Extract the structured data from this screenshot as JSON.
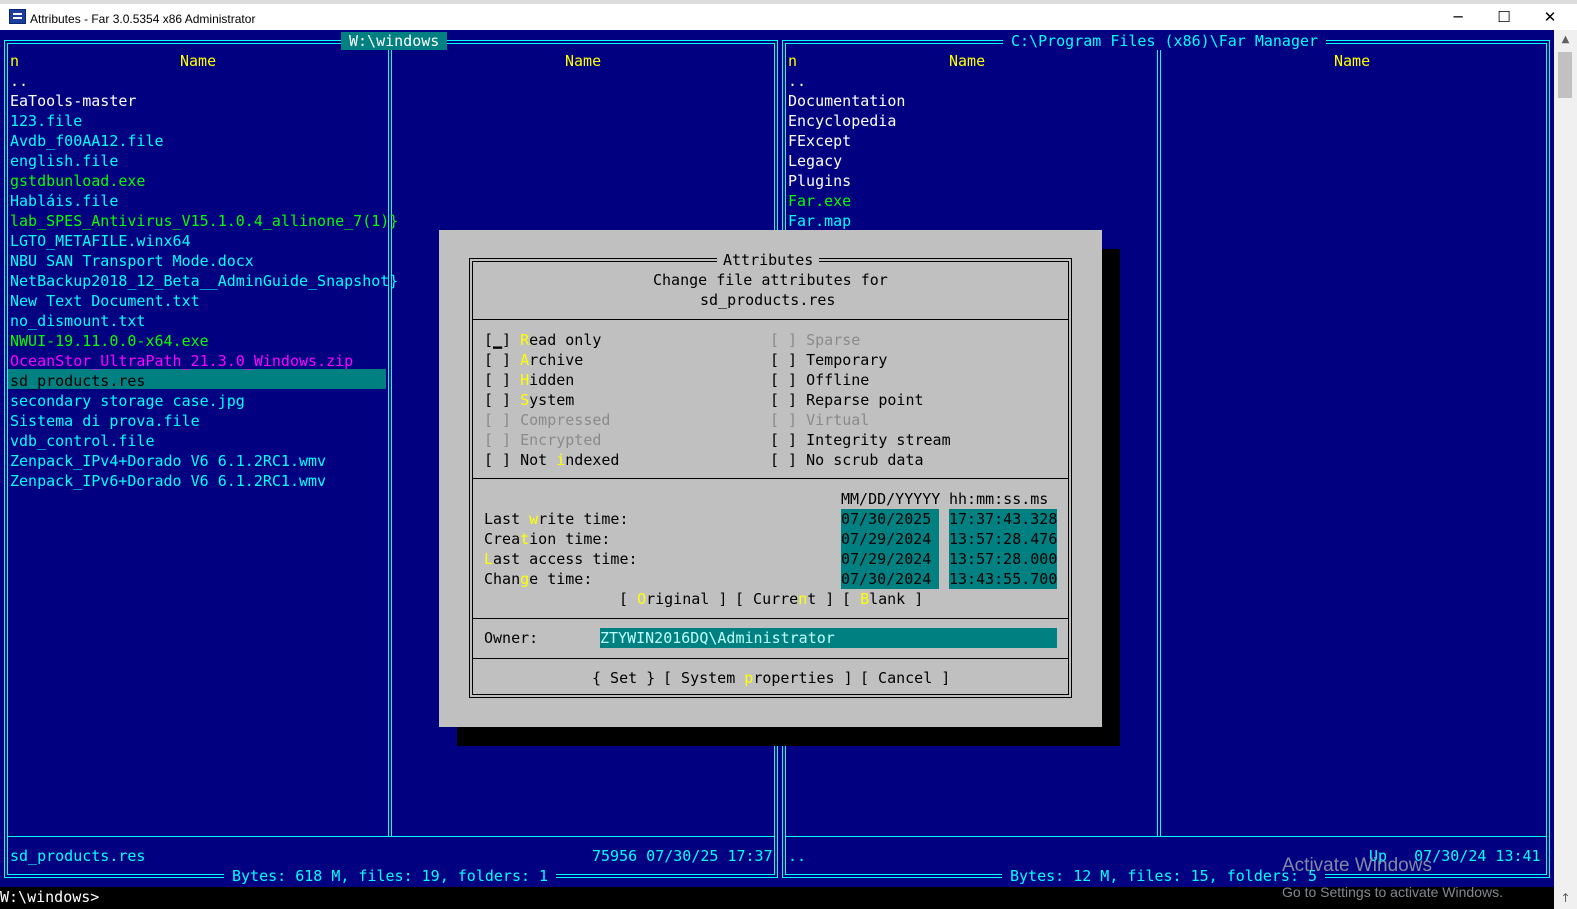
{
  "window": {
    "title": "Attributes - Far 3.0.5354 x86 Administrator",
    "minimize": "─",
    "maximize": "☐",
    "close": "✕"
  },
  "left_panel": {
    "path": "W:\\windows",
    "col_sort": "n",
    "col1_header": "Name",
    "col2_header": "Name",
    "files": [
      {
        "name": "..",
        "color": "white"
      },
      {
        "name": "EaTools-master",
        "color": "white"
      },
      {
        "name": "123.file",
        "color": "cyan"
      },
      {
        "name": "Avdb_f00AA12.file",
        "color": "cyan"
      },
      {
        "name": "english.file",
        "color": "cyan"
      },
      {
        "name": "gstdbunload.exe",
        "color": "green"
      },
      {
        "name": "Habláis.file",
        "color": "cyan"
      },
      {
        "name": "lab_SPES_Antivirus_V15.1.0.4_allinone_7(1)}",
        "color": "green"
      },
      {
        "name": "LGTO_METAFILE.winx64",
        "color": "cyan"
      },
      {
        "name": "NBU SAN Transport Mode.docx",
        "color": "cyan"
      },
      {
        "name": "NetBackup2018_12_Beta__AdminGuide_Snapshot}",
        "color": "cyan"
      },
      {
        "name": "New Text Document.txt",
        "color": "cyan"
      },
      {
        "name": "no_dismount.txt",
        "color": "cyan"
      },
      {
        "name": "NWUI-19.11.0.0-x64.exe",
        "color": "green"
      },
      {
        "name": "OceanStor_UltraPath_21.3.0_Windows.zip",
        "color": "magenta"
      },
      {
        "name": "sd_products.res",
        "color": "selected"
      },
      {
        "name": "secondary storage case.jpg",
        "color": "cyan"
      },
      {
        "name": "Sistema di prova.file",
        "color": "cyan"
      },
      {
        "name": "vdb_control.file",
        "color": "cyan"
      },
      {
        "name": "Zenpack_IPv4+Dorado V6 6.1.2RC1.wmv",
        "color": "cyan"
      },
      {
        "name": "Zenpack_IPv6+Dorado V6 6.1.2RC1.wmv",
        "color": "cyan"
      }
    ],
    "status_name": "sd_products.res",
    "status_info": "75956 07/30/25 17:37",
    "summary": "Bytes: 618 M, files: 19, folders: 1"
  },
  "right_panel": {
    "path": "C:\\Program Files (x86)\\Far Manager",
    "col_sort": "n",
    "col1_header": "Name",
    "col2_header": "Name",
    "files": [
      {
        "name": "..",
        "color": "white"
      },
      {
        "name": "Documentation",
        "color": "white"
      },
      {
        "name": "Encyclopedia",
        "color": "white"
      },
      {
        "name": "FExcept",
        "color": "white"
      },
      {
        "name": "Legacy",
        "color": "white"
      },
      {
        "name": "Plugins",
        "color": "white"
      },
      {
        "name": "Far.exe",
        "color": "green"
      },
      {
        "name": "Far.map",
        "color": "cyan"
      }
    ],
    "status_name": "..",
    "status_info": "Up   07/30/24 13:41",
    "summary": "Bytes: 12 M, files: 15, folders: 5"
  },
  "dialog": {
    "title": "Attributes",
    "subtitle": "Change file attributes for",
    "filename": "sd_products.res",
    "attributes_left": [
      {
        "box": "[▁]",
        "hot": "R",
        "rest": "ead only",
        "disabled": false,
        "pre": ""
      },
      {
        "box": "[ ]",
        "hot": "A",
        "rest": "rchive",
        "disabled": false,
        "pre": ""
      },
      {
        "box": "[ ]",
        "hot": "H",
        "rest": "idden",
        "disabled": false,
        "pre": ""
      },
      {
        "box": "[ ]",
        "hot": "S",
        "rest": "ystem",
        "disabled": false,
        "pre": ""
      },
      {
        "box": "[ ]",
        "hot": "",
        "rest": "Compressed",
        "disabled": true,
        "pre": ""
      },
      {
        "box": "[ ]",
        "hot": "",
        "rest": "Encrypted",
        "disabled": true,
        "pre": ""
      },
      {
        "box": "[ ]",
        "hot": "i",
        "rest": "ndexed",
        "disabled": false,
        "pre": "Not "
      }
    ],
    "attributes_right": [
      {
        "box": "[ ]",
        "label": "Sparse",
        "disabled": true
      },
      {
        "box": "[ ]",
        "label": "Temporary",
        "disabled": false
      },
      {
        "box": "[ ]",
        "label": "Offline",
        "disabled": false
      },
      {
        "box": "[ ]",
        "label": "Reparse point",
        "disabled": false
      },
      {
        "box": "[ ]",
        "label": "Virtual",
        "disabled": true
      },
      {
        "box": "[ ]",
        "label": "Integrity stream",
        "disabled": false
      },
      {
        "box": "[ ]",
        "label": "No scrub data",
        "disabled": false
      }
    ],
    "date_header": "MM/DD/YYYYY",
    "time_header": "hh:mm:ss.ms",
    "times": [
      {
        "pre": "Last ",
        "hot": "w",
        "post": "rite time:",
        "date": "07/30/2025",
        "time": "17:37:43.328"
      },
      {
        "pre": "Crea",
        "hot": "t",
        "post": "ion time:",
        "date": "07/29/2024",
        "time": "13:57:28.476"
      },
      {
        "pre": "",
        "hot": "L",
        "post": "ast access time:",
        "date": "07/29/2024",
        "time": "13:57:28.000"
      },
      {
        "pre": "Chan",
        "hot": "g",
        "post": "e time:",
        "date": "07/30/2024",
        "time": "13:43:55.700"
      }
    ],
    "time_buttons": {
      "original_open": "[ ",
      "original_hot": "O",
      "original_rest": "riginal ]",
      "current_open": "[ Curre",
      "current_hot": "n",
      "current_rest": "t ]",
      "blank_open": "[ ",
      "blank_hot": "B",
      "blank_rest": "lank ]"
    },
    "owner_label": "Owner:",
    "owner_value": "ZTYWIN2016DQ\\Administrator",
    "buttons": {
      "set": "{ Set }",
      "sysprops_open": "[ System ",
      "sysprops_hot": "p",
      "sysprops_rest": "roperties ]",
      "cancel": "[ Cancel ]"
    }
  },
  "command_line": "W:\\windows>",
  "watermark": {
    "line1": "Activate Windows",
    "line2": "Go to Settings to activate Windows."
  }
}
